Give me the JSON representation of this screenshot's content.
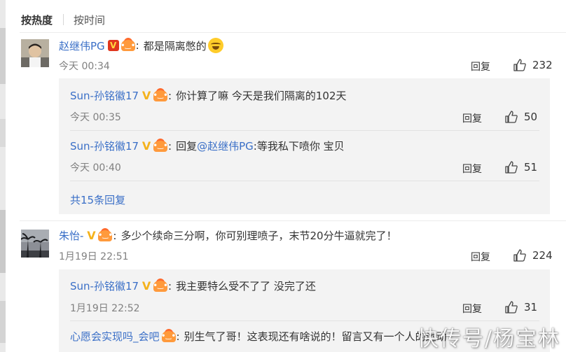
{
  "sort": {
    "hot": "按热度",
    "time": "按时间"
  },
  "reply_label": "回复",
  "comments": [
    {
      "user": "赵继伟PG",
      "text": "都是隔离憋的",
      "time": "今天 00:34",
      "likes": "232",
      "replies": [
        {
          "user": "Sun-孙铭徽17",
          "text": "你计算了嘛 今天是我们隔离的102天",
          "time": "今天 00:35",
          "likes": "50"
        },
        {
          "user": "Sun-孙铭徽17",
          "text_prefix": "回复",
          "mention": "@赵继伟PG",
          "text": ":等我私下喷你 宝贝",
          "time": "今天 00:40",
          "likes": "51"
        }
      ],
      "more_replies": "共15条回复"
    },
    {
      "user": "朱怡-",
      "text": "多少个续命三分啊，你可别理喷子，末节20分牛逼就完了！",
      "time": "1月19日 22:51",
      "likes": "224",
      "replies": [
        {
          "user": "Sun-孙铭徽17",
          "text": "我主要特么受不了了 没完了还",
          "time": "1月19日 22:52",
          "likes": "31"
        },
        {
          "user": "心愿会实现吗_会吧",
          "text": "别生气了哥！这表现还有啥说的！留言又有一个人的运动"
        }
      ]
    }
  ],
  "watermark": "快传号/杨宝林",
  "colors": {
    "link": "#3a6fc7",
    "verified_red": "#e0371e",
    "verified_yellow": "#f4b21b",
    "fans_badge": "#ff9a3c",
    "reply_bg": "#f3f3f3"
  }
}
